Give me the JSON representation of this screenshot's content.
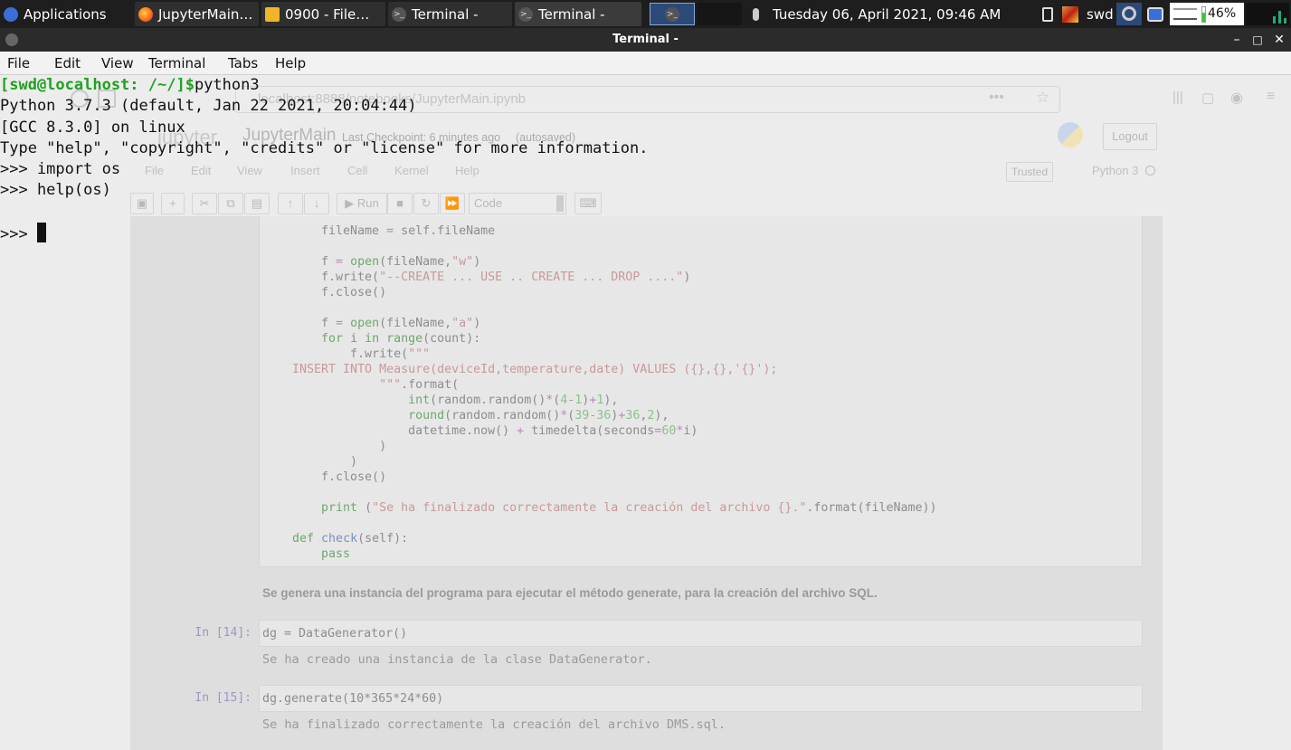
{
  "panel": {
    "applications": "Applications",
    "tasks": [
      {
        "label": "JupyterMain…",
        "icon": "firefox-icon"
      },
      {
        "label": "0900 - File…",
        "icon": "folder-icon"
      },
      {
        "label": "Terminal -",
        "icon": "terminal-icon"
      },
      {
        "label": "Terminal -",
        "icon": "terminal-icon"
      }
    ],
    "clock": "Tuesday 06, April 2021, 09:46 AM",
    "user": "swd",
    "battery": "46%"
  },
  "window": {
    "title": "Terminal -",
    "minimize": "–",
    "maximize": "□",
    "close": "✕"
  },
  "menu": {
    "file": "File",
    "edit": "Edit",
    "view": "View",
    "terminal": "Terminal",
    "tabs": "Tabs",
    "help": "Help"
  },
  "terminal": {
    "prompt": "[swd@localhost: /~/]$",
    "command": "python3",
    "lines": [
      "Python 3.7.3 (default, Jan 22 2021, 20:04:44)",
      "[GCC 8.3.0] on linux",
      "Type \"help\", \"copyright\", \"credits\" or \"license\" for more information.",
      ">>> import os",
      ">>> help(os)",
      "",
      ">>> "
    ]
  },
  "jupyter": {
    "url": "localhost:8888/notebooks/JupyterMain.ipynb",
    "logo": "jupyter",
    "notebook_name": "JupyterMain",
    "checkpoint": "Last Checkpoint: 6 minutes ago",
    "autosaved": "(autosaved)",
    "logout": "Logout",
    "menus": [
      "File",
      "Edit",
      "View",
      "Insert",
      "Cell",
      "Kernel",
      "Help"
    ],
    "trusted": "Trusted",
    "kernel": "Python 3",
    "run": "Run",
    "cell_type": "Code",
    "markdown": "Se genera una instancia del programa para ejecutar el método generate, para la creación del archivo SQL.",
    "cells": [
      {
        "prompt": "In [14]:",
        "code": "dg = DataGenerator()",
        "output": "Se ha creado una instancia de la clase DataGenerator."
      },
      {
        "prompt": "In [15]:",
        "code": "dg.generate(10*365*24*60)",
        "output": "Se ha finalizado correctamente la creación del archivo DMS.sql."
      }
    ]
  }
}
